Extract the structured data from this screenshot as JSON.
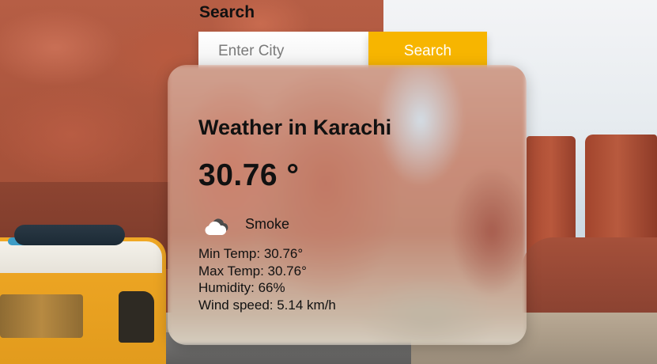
{
  "search": {
    "label": "Search",
    "placeholder": "Enter City",
    "value": "",
    "button_label": "Search"
  },
  "weather": {
    "title": "Weather in Karachi",
    "temperature": "30.76 °",
    "condition_icon": "cloud-icon",
    "condition": "Smoke",
    "min_temp": "Min Temp: 30.76°",
    "max_temp": "Max Temp: 30.76°",
    "humidity": "Humidity: 66%",
    "wind_speed": "Wind speed: 5.14 km/h"
  },
  "colors": {
    "search_button": "#f7b500",
    "text": "#111111"
  }
}
